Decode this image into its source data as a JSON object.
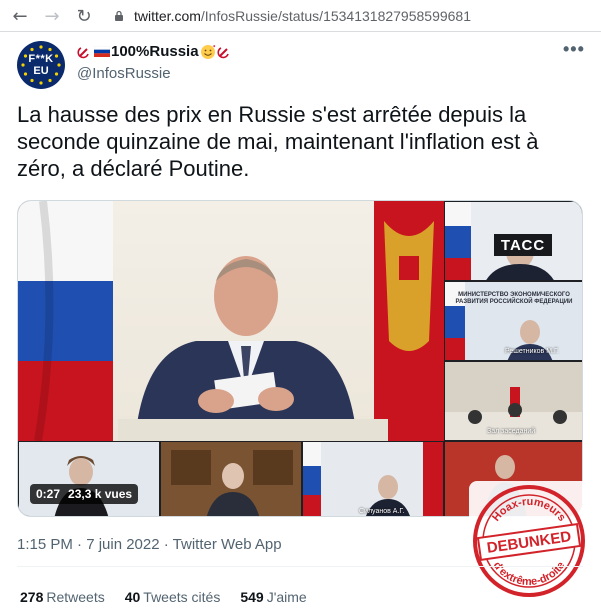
{
  "browser": {
    "url_host": "twitter.com",
    "url_path": "/InfosRussie/status/1534131827958599681"
  },
  "tweet": {
    "avatar_text_top": "F**K",
    "avatar_text_bottom": "EU",
    "display_name": "100%Russia",
    "handle": "@InfosRussie",
    "more_label": "•••",
    "text": "La hausse des prix en Russie s'est arrêtée depuis la seconde quinzaine de mai, maintenant l'inflation est à zéro, a déclaré Poutine.",
    "timestamp": "1:15 PM · 7 juin 2022 · Twitter Web App"
  },
  "media": {
    "duration": "0:27",
    "views": "23,3 k vues",
    "tass_logo": "ТАСС",
    "ministry_text": "МИНИСТЕРСТВО ЭКОНОМИЧЕСКОГО РАЗВИТИЯ РОССИЙСКОЙ ФЕДЕРАЦИИ",
    "caption_reshetnikov": "Решетников М.Г.",
    "caption_hall": "Зал заседаний",
    "caption_siluanov": "Силуанов А.Г."
  },
  "stamp": {
    "top_text": "Hoax-rumeurs",
    "center_text": "DEBUNKED",
    "bottom_text": "d'extrême-droite",
    "color": "#d2232a"
  },
  "stats": {
    "retweets_count": "278",
    "retweets_label": "Retweets",
    "quotes_count": "40",
    "quotes_label": "Tweets cités",
    "likes_count": "549",
    "likes_label": "J'aime"
  }
}
